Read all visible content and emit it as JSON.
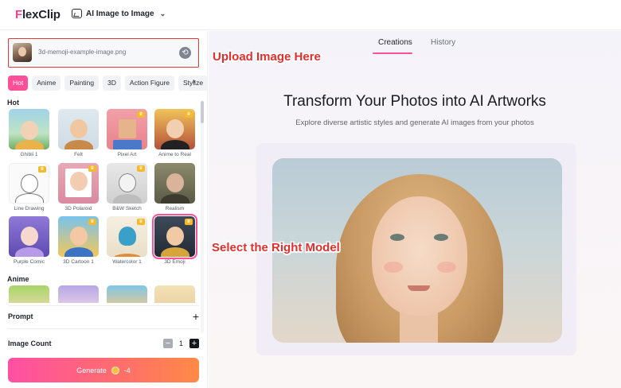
{
  "header": {
    "logo": {
      "first": "F",
      "rest": "lexClip"
    },
    "tool_label": "AI Image to Image"
  },
  "upload": {
    "file_name": "3d-memoji-example-image.png"
  },
  "style_tabs": [
    "Hot",
    "Anime",
    "Painting",
    "3D",
    "Action Figure",
    "Stylize"
  ],
  "sections": {
    "hot": "Hot",
    "anime": "Anime"
  },
  "models": [
    {
      "label": "Ghibli 1",
      "premium": false
    },
    {
      "label": "Felt",
      "premium": false
    },
    {
      "label": "Pixel Art",
      "premium": true
    },
    {
      "label": "Anime to Real",
      "premium": true
    },
    {
      "label": "Line Drawing",
      "premium": true
    },
    {
      "label": "3D Polaroid",
      "premium": true
    },
    {
      "label": "B&W Sketch",
      "premium": true
    },
    {
      "label": "Realism",
      "premium": false
    },
    {
      "label": "Purple Comic",
      "premium": false
    },
    {
      "label": "3D Cartoon 1",
      "premium": true
    },
    {
      "label": "Watercolor 1",
      "premium": true
    },
    {
      "label": "3D Emoji",
      "premium": true,
      "selected": true
    }
  ],
  "prompt_label": "Prompt",
  "image_count": {
    "label": "Image Count",
    "value": "1"
  },
  "generate": {
    "label": "Generate",
    "cost": "-4"
  },
  "right_tabs": {
    "creations": "Creations",
    "history": "History"
  },
  "hero": {
    "title": "Transform Your Photos into AI Artworks",
    "subtitle": "Explore diverse artistic styles and generate AI images from your photos"
  },
  "annotations": {
    "upload": "Upload Image Here",
    "model": "Select the Right Model"
  },
  "colors": {
    "accent": "#ff4f9a",
    "annotation": "#e0302e"
  }
}
